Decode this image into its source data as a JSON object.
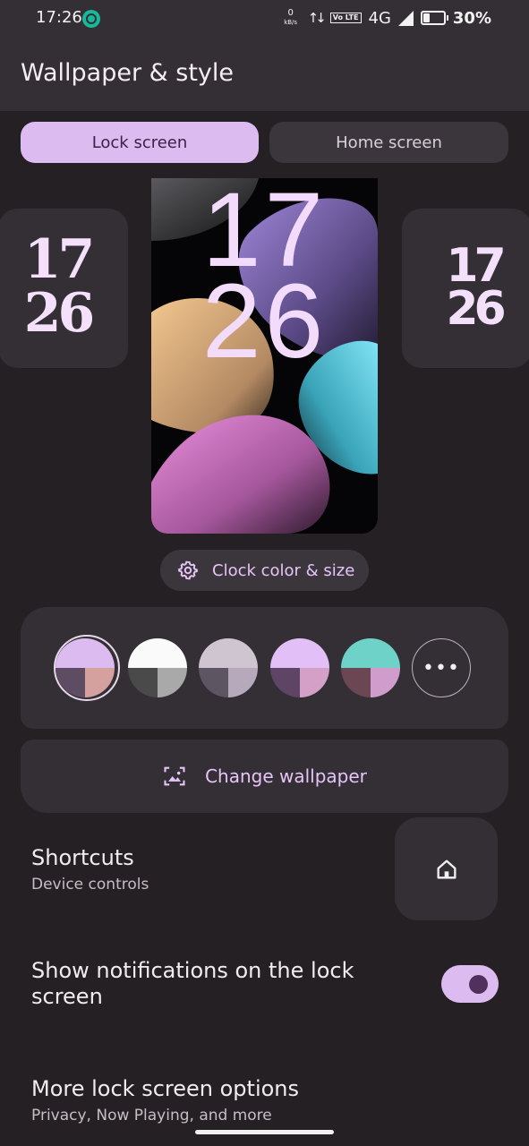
{
  "status_bar": {
    "time": "17:26",
    "data_speed_value": "0",
    "data_speed_unit": "kB/s",
    "volte": "Vo LTE",
    "network": "4G",
    "battery": "30%",
    "icons": [
      "notification-app-icon",
      "data-arrows-icon",
      "signal-icon",
      "battery-icon"
    ]
  },
  "header": {
    "title": "Wallpaper & style"
  },
  "tabs": [
    {
      "label": "Lock screen",
      "selected": true
    },
    {
      "label": "Home screen",
      "selected": false
    }
  ],
  "clock_previews": {
    "left": {
      "hours": "17",
      "minutes": "26"
    },
    "center": {
      "hours": "17",
      "minutes": "26"
    },
    "right": {
      "hours": "17",
      "minutes": "26"
    }
  },
  "clock_settings": {
    "label": "Clock color & size",
    "icon": "gear-icon"
  },
  "color_palettes": {
    "selected_index": 0,
    "swatches": [
      {
        "top": "#dcbbf1",
        "bottom_left": "#5e4d62",
        "bottom_right": "#d4a19f"
      },
      {
        "top": "#fafafa",
        "bottom_left": "#4a4a4a",
        "bottom_right": "#a9a9a9"
      },
      {
        "top": "#cfc5d1",
        "bottom_left": "#5d5562",
        "bottom_right": "#b7a9bc"
      },
      {
        "top": "#e3bff7",
        "bottom_left": "#5e4566",
        "bottom_right": "#d4a0c8"
      },
      {
        "top": "#6fd2c9",
        "bottom_left": "#6b4753",
        "bottom_right": "#d09ccc"
      }
    ],
    "more_icon": "more-horizontal-icon"
  },
  "change_wallpaper": {
    "label": "Change wallpaper",
    "icon": "wallpaper-icon"
  },
  "shortcuts": {
    "title": "Shortcuts",
    "subtitle": "Device controls",
    "icon": "home-icon"
  },
  "notifications": {
    "title": "Show notifications on the lock screen",
    "enabled": true
  },
  "more_options": {
    "title": "More lock screen options",
    "subtitle": "Privacy, Now Playing, and more"
  },
  "colors": {
    "background": "#242024",
    "surface": "#332f35",
    "accent": "#dcbbf1",
    "accent_text": "#e6c4f8"
  }
}
